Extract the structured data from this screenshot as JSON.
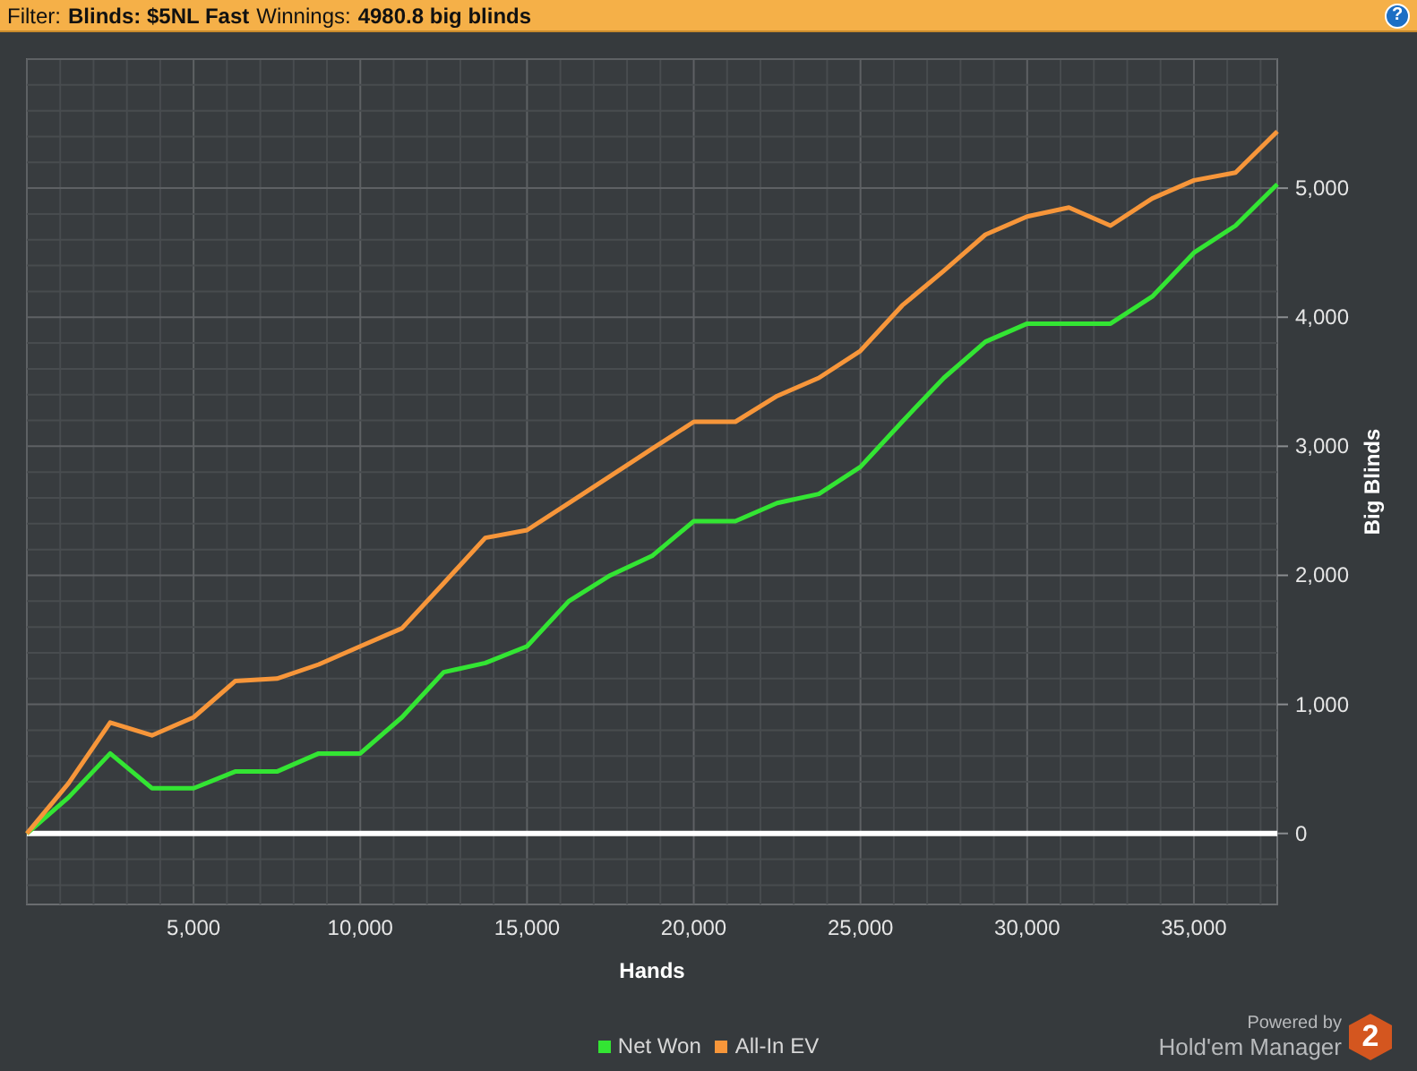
{
  "filter_bar": {
    "filter_label": "Filter:",
    "filter_value": "Blinds: $5NL Fast",
    "winnings_label": "Winnings:",
    "winnings_value": "4980.8 big blinds",
    "help_button": "?"
  },
  "chart": {
    "chart_data": {
      "type": "line",
      "grid": true,
      "xlabel": "Hands",
      "ylabel": "Big Blinds",
      "xlim": [
        0,
        37500
      ],
      "ylim": [
        -550,
        6000
      ],
      "xticks": [
        {
          "value": 5000,
          "label": "5,000"
        },
        {
          "value": 10000,
          "label": "10,000"
        },
        {
          "value": 15000,
          "label": "15,000"
        },
        {
          "value": 20000,
          "label": "20,000"
        },
        {
          "value": 25000,
          "label": "25,000"
        },
        {
          "value": 30000,
          "label": "30,000"
        },
        {
          "value": 35000,
          "label": "35,000"
        }
      ],
      "yticks": [
        {
          "value": 0,
          "label": "0"
        },
        {
          "value": 1000,
          "label": "1,000"
        },
        {
          "value": 2000,
          "label": "2,000"
        },
        {
          "value": 3000,
          "label": "3,000"
        },
        {
          "value": 4000,
          "label": "4,000"
        },
        {
          "value": 5000,
          "label": "5,000"
        }
      ],
      "x": [
        0,
        1250,
        2500,
        3750,
        5000,
        6250,
        7500,
        8750,
        10000,
        11250,
        12500,
        13750,
        15000,
        16250,
        17500,
        18750,
        20000,
        21250,
        22500,
        23750,
        25000,
        26250,
        27500,
        28750,
        30000,
        31250,
        32500,
        33750,
        35000,
        36250,
        37500
      ],
      "series": [
        {
          "name": "Net Won",
          "color": "#33e533",
          "values": [
            0,
            280,
            620,
            350,
            350,
            480,
            480,
            620,
            620,
            900,
            1250,
            1320,
            1450,
            1800,
            2000,
            2150,
            2420,
            2420,
            2560,
            2630,
            2840,
            3190,
            3530,
            3810,
            3950,
            3950,
            3950,
            4160,
            4500,
            4710,
            5030
          ]
        },
        {
          "name": "All-In EV",
          "color": "#f7963a",
          "values": [
            0,
            390,
            860,
            760,
            900,
            1180,
            1200,
            1310,
            1450,
            1590,
            1940,
            2290,
            2350,
            2560,
            2770,
            2980,
            3190,
            3190,
            3390,
            3530,
            3740,
            4090,
            4360,
            4640,
            4780,
            4850,
            4710,
            4920,
            5060,
            5120,
            5440
          ]
        }
      ]
    }
  },
  "footer": {
    "powered_by": "Powered by",
    "product_name": "Hold'em Manager",
    "logo_mark": "2"
  }
}
